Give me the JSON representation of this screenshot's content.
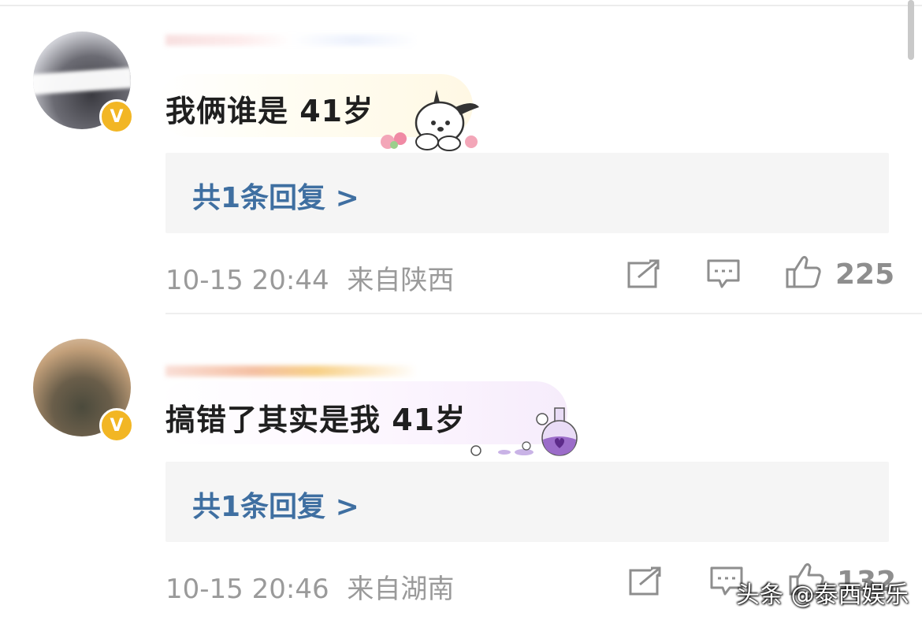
{
  "comments": [
    {
      "text": "我俩谁是 41岁",
      "reply_label": "共1条回复 >",
      "timestamp": "10-15 20:44",
      "location": "来自陕西",
      "likes": "225",
      "avatar_badge": "V"
    },
    {
      "text": "搞错了其实是我 41岁",
      "reply_label": "共1条回复 >",
      "timestamp": "10-15 20:46",
      "location": "来自湖南",
      "likes": "132",
      "avatar_badge": "V"
    }
  ],
  "icons": {
    "share": "share-icon",
    "comment": "comment-icon",
    "like": "thumbs-up-icon",
    "verified": "verified-badge-icon"
  },
  "colors": {
    "reply_link": "#3f6fa1",
    "meta_text": "#9a9a9a",
    "verified_badge": "#f2b624"
  },
  "watermark": "头条 @泰西娱乐"
}
